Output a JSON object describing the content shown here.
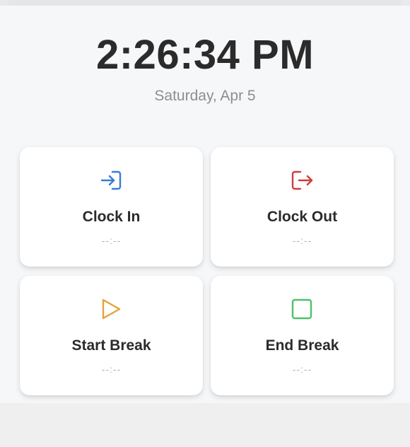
{
  "header": {
    "time": "2:26:34 PM",
    "date": "Saturday, Apr 5"
  },
  "actions": [
    {
      "label": "Clock In",
      "time": "--:--",
      "icon": "login-icon",
      "color": "#3a7bd5"
    },
    {
      "label": "Clock Out",
      "time": "--:--",
      "icon": "logout-icon",
      "color": "#d23b3b"
    },
    {
      "label": "Start Break",
      "time": "--:--",
      "icon": "play-icon",
      "color": "#e6a23c"
    },
    {
      "label": "End Break",
      "time": "--:--",
      "icon": "stop-icon",
      "color": "#4cc26a"
    }
  ]
}
